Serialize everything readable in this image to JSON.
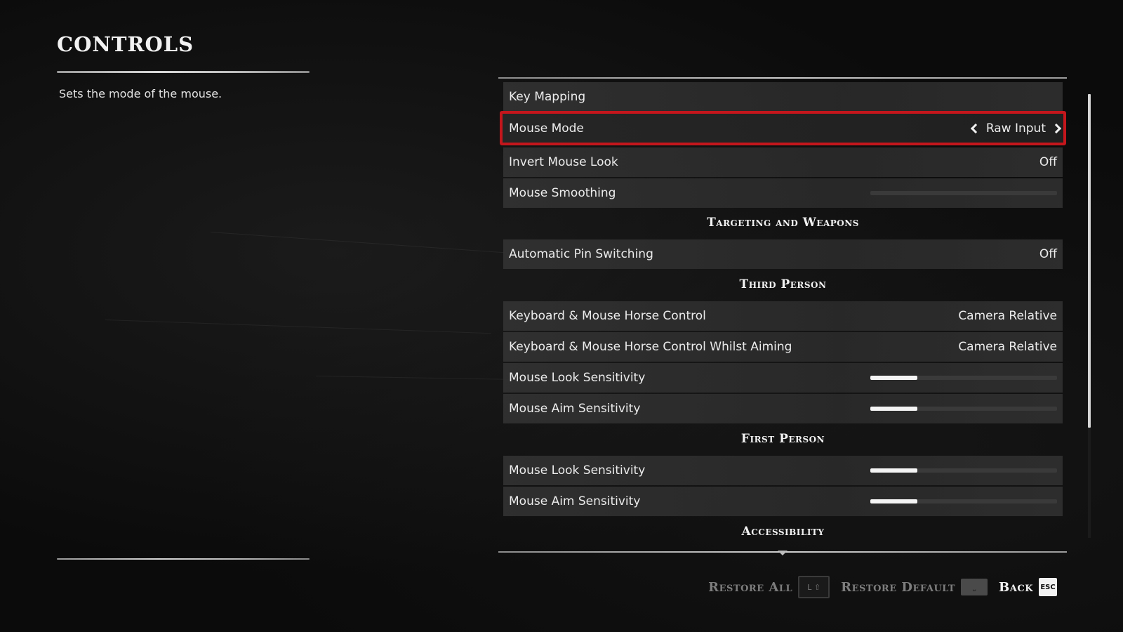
{
  "page": {
    "title": "CONTROLS",
    "description": "Sets the mode of the mouse."
  },
  "rows": [
    {
      "type": "row",
      "label": "Key Mapping",
      "value": ""
    },
    {
      "type": "row",
      "label": "Mouse Mode",
      "value": "Raw Input",
      "selected": true
    },
    {
      "type": "row",
      "label": "Invert Mouse Look",
      "value": "Off"
    },
    {
      "type": "slider",
      "label": "Mouse Smoothing",
      "level": 0.0
    },
    {
      "type": "section",
      "label": "Targeting and Weapons"
    },
    {
      "type": "row",
      "label": "Automatic Pin Switching",
      "value": "Off"
    },
    {
      "type": "section",
      "label": "Third Person"
    },
    {
      "type": "row",
      "label": "Keyboard & Mouse Horse Control",
      "value": "Camera Relative"
    },
    {
      "type": "row",
      "label": "Keyboard & Mouse Horse Control Whilst Aiming",
      "value": "Camera Relative"
    },
    {
      "type": "slider",
      "label": "Mouse Look Sensitivity",
      "level": 0.25
    },
    {
      "type": "slider",
      "label": "Mouse Aim Sensitivity",
      "level": 0.25
    },
    {
      "type": "section",
      "label": "First Person"
    },
    {
      "type": "slider",
      "label": "Mouse Look Sensitivity",
      "level": 0.25
    },
    {
      "type": "slider",
      "label": "Mouse Aim Sensitivity",
      "level": 0.25
    },
    {
      "type": "section",
      "label": "Accessibility"
    }
  ],
  "footer": {
    "restore_all_label": "Restore All",
    "restore_default_label": "Restore Default",
    "back_label": "Back",
    "back_key": "ESC"
  },
  "colors": {
    "highlight": "#c4161c",
    "background": "#0b0b0b"
  }
}
